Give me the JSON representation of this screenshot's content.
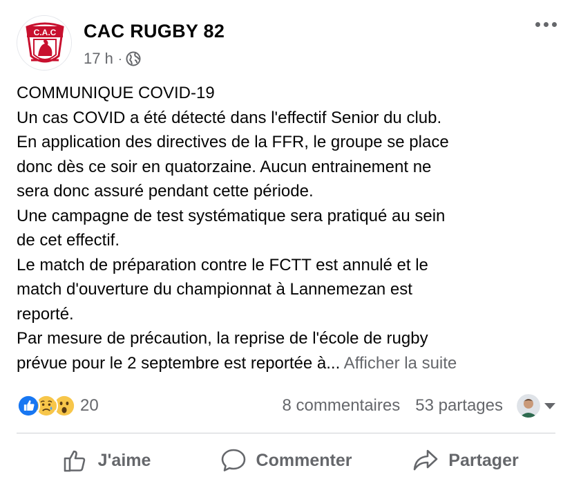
{
  "post": {
    "author": "CAC RUGBY 82",
    "avatar_logo_text": "C.A.C",
    "time": "17 h",
    "separator": "·",
    "privacy_icon": "globe-icon",
    "menu_icon": "more-options-icon",
    "lines": [
      "COMMUNIQUE COVID-19",
      "Un cas COVID a été détecté dans l'effectif Senior du club.",
      "En application des directives de la FFR, le groupe se place",
      "donc dès ce soir en quatorzaine. Aucun entrainement ne",
      "sera donc assuré pendant cette période.",
      "Une campagne de test systématique sera pratiqué au sein",
      "de cet effectif.",
      "Le match de préparation contre le FCTT est annulé et le",
      "match d'ouverture du championnat à Lannemezan est",
      "reporté.",
      "Par mesure de précaution, la reprise de l'école de rugby",
      "prévue pour le 2 septembre est reportée à..."
    ],
    "see_more": "Afficher la suite"
  },
  "stats": {
    "reactions": [
      "like-reaction-icon",
      "sad-reaction-icon",
      "wow-reaction-icon"
    ],
    "reaction_count": "20",
    "comments": "8 commentaires",
    "shares": "53 partages"
  },
  "actions": {
    "like": "J'aime",
    "comment": "Commenter",
    "share": "Partager"
  },
  "colors": {
    "text": "#050505",
    "secondary": "#65676b",
    "like_blue": "#1877f2",
    "reaction_yellow": "#f7c64a",
    "logo_red": "#c8102e"
  }
}
